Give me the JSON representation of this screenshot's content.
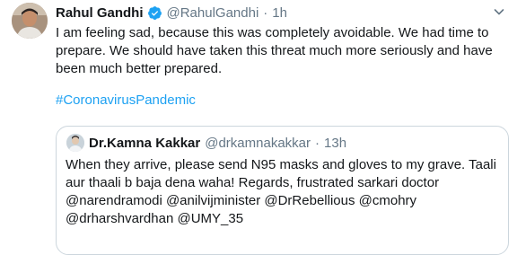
{
  "tweet": {
    "author_name": "Rahul Gandhi",
    "author_handle": "@RahulGandhi",
    "separator": "·",
    "time": "1h",
    "text": "I am feeling sad, because this was completely avoidable. We had time to prepare. We should have taken this threat much more seriously and have been much better prepared.",
    "hashtag": "#CoronavirusPandemic"
  },
  "quoted": {
    "author_name": "Dr.Kamna Kakkar",
    "author_handle": "@drkamnakakkar",
    "separator": "·",
    "time": "13h",
    "text": "When they arrive, please send N95 masks and gloves to my grave. Taali aur thaali b baja dena waha! Regards, frustrated sarkari doctor @narendramodi @anilvijminister @DrRebellious @cmohry @drharshvardhan @UMY_35"
  },
  "colors": {
    "link": "#1da1f2",
    "muted": "#657786",
    "text": "#14171a",
    "border": "#ccd6dd"
  },
  "icons": {
    "verified": "verified-badge-icon",
    "menu": "chevron-down-icon"
  }
}
